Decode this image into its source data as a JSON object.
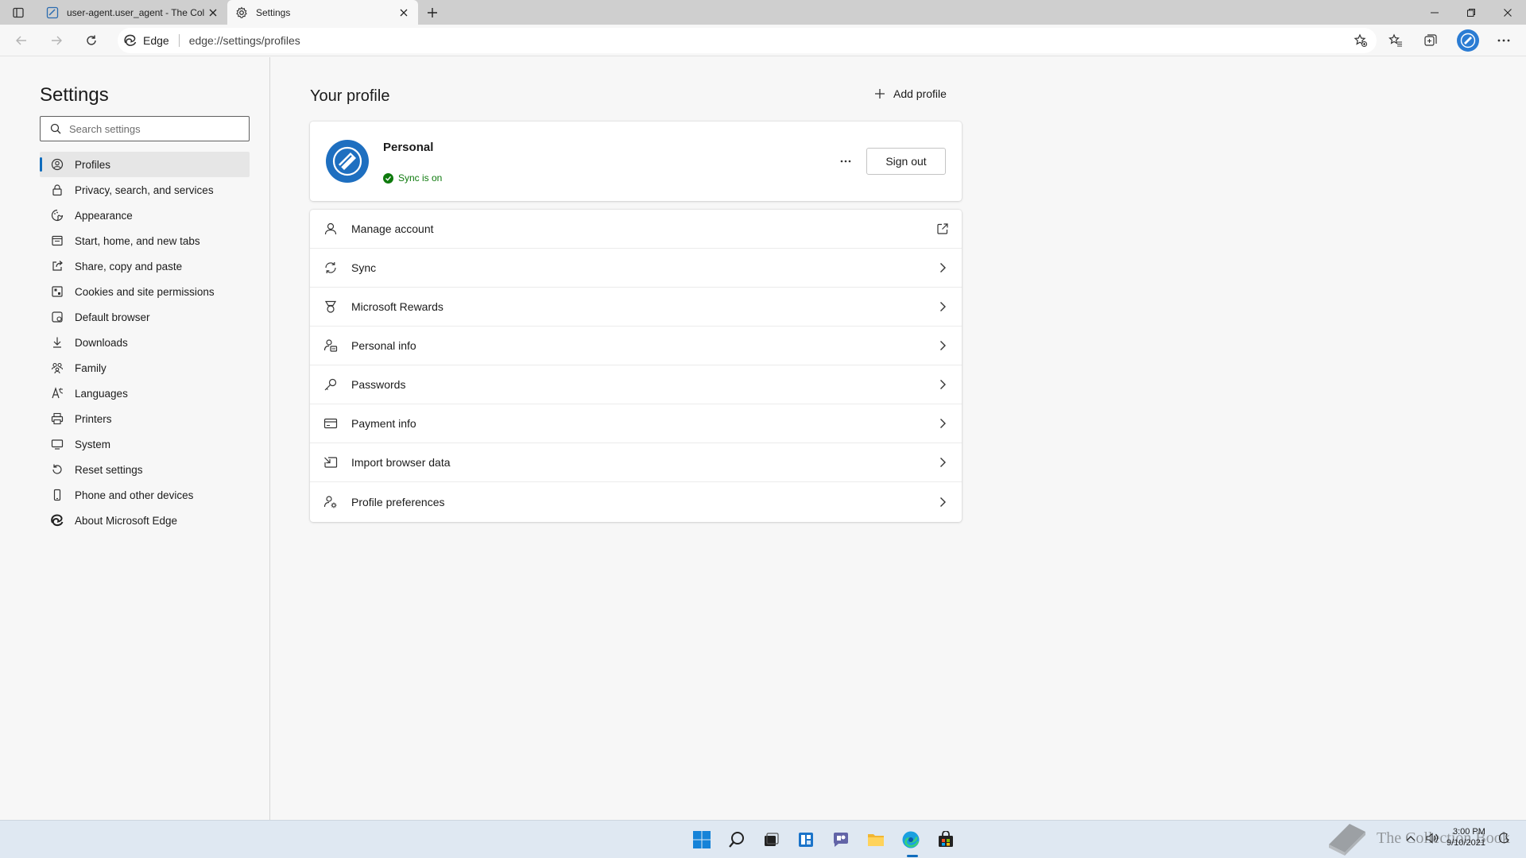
{
  "browser": {
    "tabs": [
      {
        "title": "user-agent.user_agent - The Coll",
        "favicon": "collection-book-icon",
        "active": false
      },
      {
        "title": "Settings",
        "favicon": "gear-icon",
        "active": true
      }
    ],
    "address": {
      "site_label": "Edge",
      "url": "edge://settings/profiles"
    }
  },
  "sidebar": {
    "title": "Settings",
    "search_placeholder": "Search settings",
    "items": [
      {
        "label": "Profiles",
        "icon": "profile-icon",
        "selected": true
      },
      {
        "label": "Privacy, search, and services",
        "icon": "lock-icon"
      },
      {
        "label": "Appearance",
        "icon": "appearance-icon"
      },
      {
        "label": "Start, home, and new tabs",
        "icon": "start-icon"
      },
      {
        "label": "Share, copy and paste",
        "icon": "share-icon"
      },
      {
        "label": "Cookies and site permissions",
        "icon": "cookies-icon"
      },
      {
        "label": "Default browser",
        "icon": "browser-icon"
      },
      {
        "label": "Downloads",
        "icon": "download-icon"
      },
      {
        "label": "Family",
        "icon": "family-icon"
      },
      {
        "label": "Languages",
        "icon": "languages-icon"
      },
      {
        "label": "Printers",
        "icon": "printer-icon"
      },
      {
        "label": "System",
        "icon": "system-icon"
      },
      {
        "label": "Reset settings",
        "icon": "reset-icon"
      },
      {
        "label": "Phone and other devices",
        "icon": "phone-icon"
      },
      {
        "label": "About Microsoft Edge",
        "icon": "edge-logo-icon"
      }
    ]
  },
  "main": {
    "title": "Your profile",
    "add_profile_label": "Add profile",
    "profile": {
      "name": "Personal",
      "sync_status": "Sync is on",
      "sign_out_label": "Sign out"
    },
    "rows": [
      {
        "label": "Manage account",
        "icon": "person-icon",
        "trailing": "external-link-icon"
      },
      {
        "label": "Sync",
        "icon": "sync-icon",
        "trailing": "chevron-right-icon"
      },
      {
        "label": "Microsoft Rewards",
        "icon": "rewards-icon",
        "trailing": "chevron-right-icon"
      },
      {
        "label": "Personal info",
        "icon": "personal-info-icon",
        "trailing": "chevron-right-icon"
      },
      {
        "label": "Passwords",
        "icon": "key-icon",
        "trailing": "chevron-right-icon"
      },
      {
        "label": "Payment info",
        "icon": "card-icon",
        "trailing": "chevron-right-icon"
      },
      {
        "label": "Import browser data",
        "icon": "import-icon",
        "trailing": "chevron-right-icon"
      },
      {
        "label": "Profile preferences",
        "icon": "profile-preferences-icon",
        "trailing": "chevron-right-icon"
      }
    ]
  },
  "taskbar": {
    "watermark": "The Collection Book",
    "time": "3:00 PM",
    "date": "9/10/2021"
  },
  "colors": {
    "accent": "#0f6cbd",
    "sync_green": "#0e7a0d",
    "tabstrip": "#cfcfcf",
    "background": "#f7f7f7"
  }
}
